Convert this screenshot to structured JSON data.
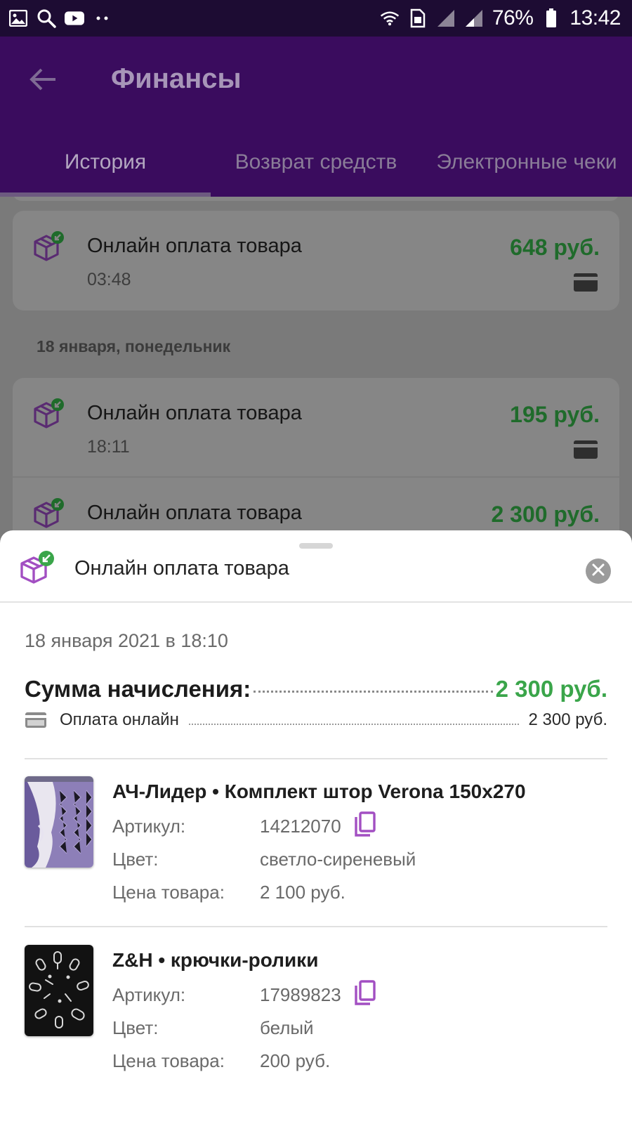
{
  "status_bar": {
    "battery": "76%",
    "time": "13:42"
  },
  "app_bar": {
    "title": "Финансы",
    "tabs": [
      {
        "label": "История",
        "active": true
      },
      {
        "label": "Возврат средств",
        "active": false
      },
      {
        "label": "Электронные чеки",
        "active": false
      }
    ]
  },
  "history": {
    "entries_top": [
      {
        "title": "Онлайн оплата товара",
        "time": "03:48",
        "amount": "648 руб."
      }
    ],
    "section_date": "18 января, понедельник",
    "entries_day": [
      {
        "title": "Онлайн оплата товара",
        "time": "18:11",
        "amount": "195 руб."
      },
      {
        "title": "Онлайн оплата товара",
        "time": "",
        "amount": "2 300 руб."
      }
    ]
  },
  "sheet": {
    "title": "Онлайн оплата товара",
    "datetime": "18 января 2021 в 18:10",
    "sum_label": "Сумма начисления:",
    "sum_value": "2 300 руб.",
    "payment_label": "Оплата онлайн",
    "payment_value": "2 300 руб.",
    "products": [
      {
        "name": "АЧ-Лидер • Комплект штор Verona 150x270",
        "article_label": "Артикул:",
        "article": "14212070",
        "color_label": "Цвет:",
        "color": "светло-сиреневый",
        "price_label": "Цена товара:",
        "price": "2 100 руб."
      },
      {
        "name": "Z&H • крючки-ролики",
        "article_label": "Артикул:",
        "article": "17989823",
        "color_label": "Цвет:",
        "color": "белый",
        "price_label": "Цена товара:",
        "price": "200 руб."
      }
    ]
  },
  "colors": {
    "brand_purple": "#3a0c5e",
    "amount_green": "#3aa54a",
    "icon_purple": "#a24fc2",
    "badge_green": "#3aa54a"
  }
}
